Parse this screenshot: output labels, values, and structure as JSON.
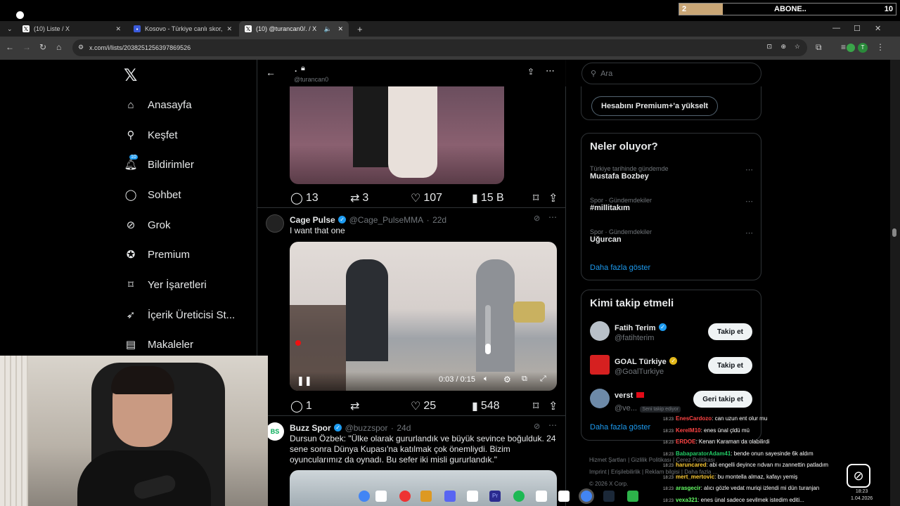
{
  "stream": {
    "abone_left": "2",
    "abone_label": "ABONE..",
    "abone_right": "10",
    "abone_progress": 0.2
  },
  "browser": {
    "tabs": [
      {
        "label": "(10) Liste / X",
        "favicon": "x-favicon"
      },
      {
        "label": "Kosovo - Türkiye canlı skor, baş",
        "favicon": "flashscore-favicon"
      },
      {
        "label": "(10) @turancan0/. / X",
        "favicon": "x-favicon"
      }
    ],
    "new_tab": "+",
    "url": "x.com/i/lists/2038251256397869526",
    "profile_initial": "T"
  },
  "nav": {
    "items": [
      {
        "label": "Anasayfa",
        "icon": "home-icon"
      },
      {
        "label": "Keşfet",
        "icon": "search-icon"
      },
      {
        "label": "Bildirimler",
        "icon": "bell-icon",
        "badge": "10"
      },
      {
        "label": "Sohbet",
        "icon": "chat-icon"
      },
      {
        "label": "Grok",
        "icon": "grok-icon"
      },
      {
        "label": "Premium",
        "icon": "premium-icon"
      },
      {
        "label": "Yer İşaretleri",
        "icon": "bookmark-icon"
      },
      {
        "label": "İçerik Üreticisi St...",
        "icon": "rocket-icon"
      },
      {
        "label": "Makaleler",
        "icon": "article-icon"
      }
    ]
  },
  "list_header": {
    "name": ".",
    "handle": "@turancan0"
  },
  "tweets": [
    {
      "stats": {
        "replies": "13",
        "retweets": "3",
        "likes": "107",
        "views": "15 B"
      }
    },
    {
      "name": "Cage Pulse",
      "handle": "@Cage_PulseMMA",
      "time": "22d",
      "text": "I want that one",
      "video_time": "0:03 / 0:15",
      "stats": {
        "replies": "1",
        "retweets": "",
        "likes": "25",
        "views": "548"
      }
    },
    {
      "name": "Buzz Spor",
      "handle": "@buzzspor",
      "time": "24d",
      "text": "Dursun Özbek: \"Ülke olarak gururlandık ve büyük sevince boğulduk. 24 sene sonra Dünya Kupası'na katılmak çok önemliydi. Bizim oyuncularımız da oynadı. Bu sefer iki misli gururlandık.\""
    }
  ],
  "right": {
    "search_placeholder": "Ara",
    "premium_button": "Hesabını Premium+'a yükselt",
    "trends_title": "Neler oluyor?",
    "trends": [
      {
        "meta": "Türkiye tarihinde gündemde",
        "name": "Mustafa Bozbey"
      },
      {
        "meta": "Spor · Gündemdekiler",
        "name": "#millitakım"
      },
      {
        "meta": "Spor · Gündemdekiler",
        "name": "Uğurcan"
      }
    ],
    "show_more": "Daha fazla göster",
    "follow_title": "Kimi takip etmeli",
    "follow": [
      {
        "name": "Fatih Terim",
        "handle": "@fatihterim",
        "button": "Takip et"
      },
      {
        "name": "GOAL Türkiye",
        "handle": "@GoalTurkiye",
        "button": "Takip et"
      },
      {
        "name": "verst",
        "handle": "@ve...",
        "badge": "Seni takip ediyor",
        "button": "Geri takip et"
      }
    ],
    "show_more_2": "Daha fazla göster",
    "footer": [
      "Hizmet Şartları",
      "Gizlilik Politikası",
      "Çerez Politikası",
      "Imprint",
      "Erişilebilirlik",
      "Reklam bilgisi",
      "Daha fazla ..."
    ],
    "copyright": "© 2026 X Corp."
  },
  "chat": [
    {
      "time": "18:23",
      "user": "EnesCardozo",
      "color": "#ff4444",
      "msg": ": can uzun ent olur mu"
    },
    {
      "time": "18:23",
      "user": "KerelM10",
      "color": "#ff4444",
      "msg": ": enes ünal çldü mü"
    },
    {
      "time": "18:23",
      "user": "ERDOE",
      "color": "#ff4444",
      "msg": ": Kenan Karaman da olabilirdi"
    },
    {
      "time": "18:23",
      "user": "BabaparatorAdam41",
      "color": "#22cc66",
      "msg": ": bende onun sayesinde 6k aldım"
    },
    {
      "time": "18:23",
      "user": "haruncared",
      "color": "#ffcc33",
      "msg": ": abi engelli deyince rıdvan mı zannettin patladım"
    },
    {
      "time": "18:23",
      "user": "mert_mertovic",
      "color": "#ffcc33",
      "msg": ": bu montella almaz, kafayı yemiş"
    },
    {
      "time": "18:23",
      "user": "arasgecir",
      "color": "#66ff66",
      "msg": ": alıcı gözle vedat muriqi izlendi mi dün turanjan"
    },
    {
      "time": "18:23",
      "user": "vexa321",
      "color": "#66ff66",
      "msg": ": enes ünal sadece sevilmek istedim editi..."
    }
  ],
  "system": {
    "clock": "18:23",
    "date": "1.04.2026"
  }
}
